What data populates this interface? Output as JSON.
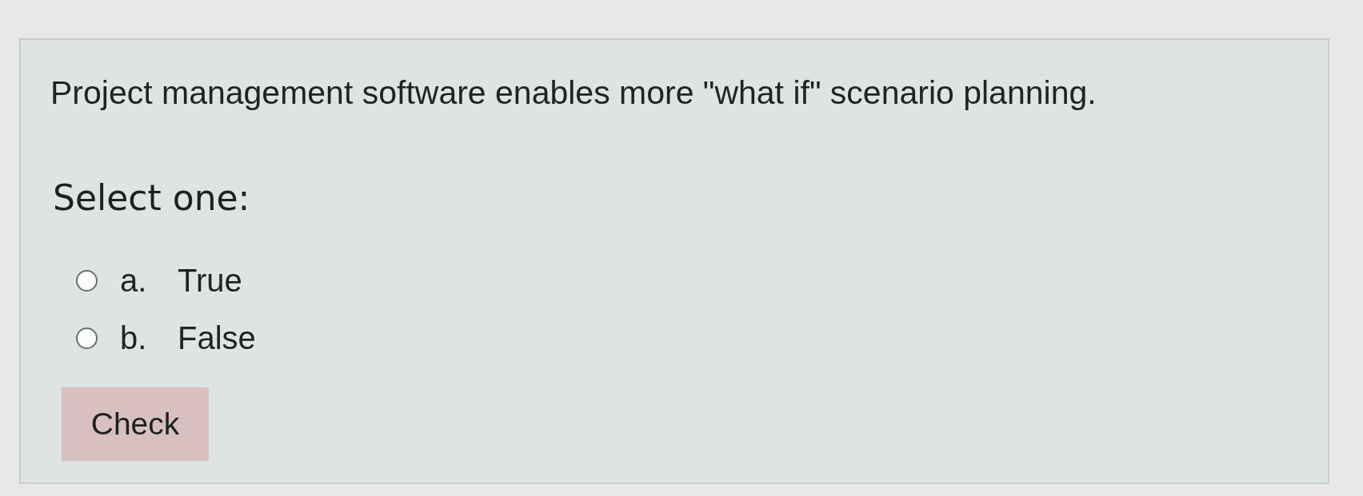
{
  "question": {
    "text": "Project management software enables more \"what if\" scenario planning."
  },
  "prompt": "Select one:",
  "options": [
    {
      "letter": "a.",
      "label": "True",
      "selected": false
    },
    {
      "letter": "b.",
      "label": "False",
      "selected": false
    }
  ],
  "buttons": [
    {
      "label": "Check"
    }
  ]
}
